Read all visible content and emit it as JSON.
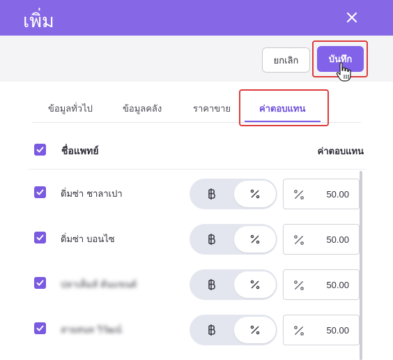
{
  "header": {
    "title": "เพิ่ม"
  },
  "actions": {
    "cancel_label": "ยกเลิก",
    "save_label": "บันทึก"
  },
  "tabs": [
    {
      "label": "ข้อมูลทั่วไป"
    },
    {
      "label": "ข้อมูลคลัง"
    },
    {
      "label": "ราคาขาย"
    },
    {
      "label": "ค่าตอบแทน",
      "active": true
    }
  ],
  "table": {
    "header_name": "ชื่อแพทย์",
    "header_fee": "ค่าตอบแทน",
    "rows": [
      {
        "name": "ดิ่มซ่า ชาลาเปา",
        "fee": "50.00",
        "checked": true,
        "mode": "percent"
      },
      {
        "name": "ดิ่มซ่า บอนไซ",
        "fee": "50.00",
        "checked": true,
        "mode": "percent"
      },
      {
        "name": "ปลาเค็มส์ ต้นแขนต์",
        "fee": "50.00",
        "checked": true,
        "mode": "percent"
      },
      {
        "name": "สายสนท วิวัฒน์",
        "fee": "50.00",
        "checked": true,
        "mode": "percent"
      }
    ]
  },
  "colors": {
    "header": "#8667e6",
    "accent": "#8162e8",
    "highlight_ring": "#dc3b3b"
  },
  "icons": {
    "close": "close-icon",
    "baht": "baht-icon",
    "percent": "percent-icon",
    "check": "check-icon",
    "cursor": "hand-cursor-icon"
  }
}
